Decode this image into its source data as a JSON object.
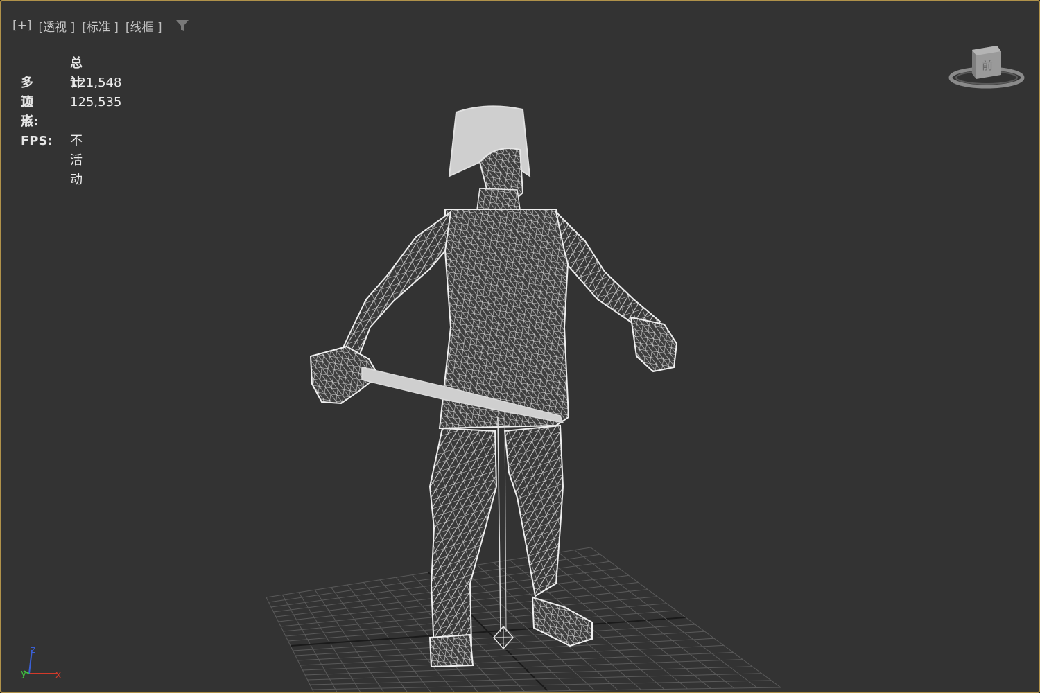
{
  "viewport": {
    "labels": [
      {
        "id": "plus",
        "open": "[",
        "text": "+",
        "close": "]"
      },
      {
        "id": "perspective",
        "open": "[",
        "text": "透视",
        "close": " ]"
      },
      {
        "id": "standard",
        "open": "[",
        "text": "标准",
        "close": " ]"
      },
      {
        "id": "wireframe",
        "open": "[",
        "text": "线框",
        "close": " ]"
      }
    ],
    "filter_icon": "filter-funnel-icon"
  },
  "stats": {
    "header": "总计",
    "polygons_label": "多边形:",
    "polygons_value": "121,548",
    "vertices_label": "顶点:",
    "vertices_value": "125,535",
    "fps_label": "FPS:",
    "fps_value": "不活动"
  },
  "viewcube": {
    "icon": "viewcube-icon",
    "face_label": "前"
  },
  "axis": {
    "x_label": "x",
    "y_label": "y",
    "z_label": "z"
  },
  "colors": {
    "viewport_bg": "#333333",
    "border_active": "#b0924a",
    "grid": "#5a5a5a",
    "grid_center": "#1a1a1a",
    "wire": "#e6e6e6",
    "axis_x": "#d43a2a",
    "axis_y": "#3fbf3f",
    "axis_z": "#3a5fd4"
  }
}
